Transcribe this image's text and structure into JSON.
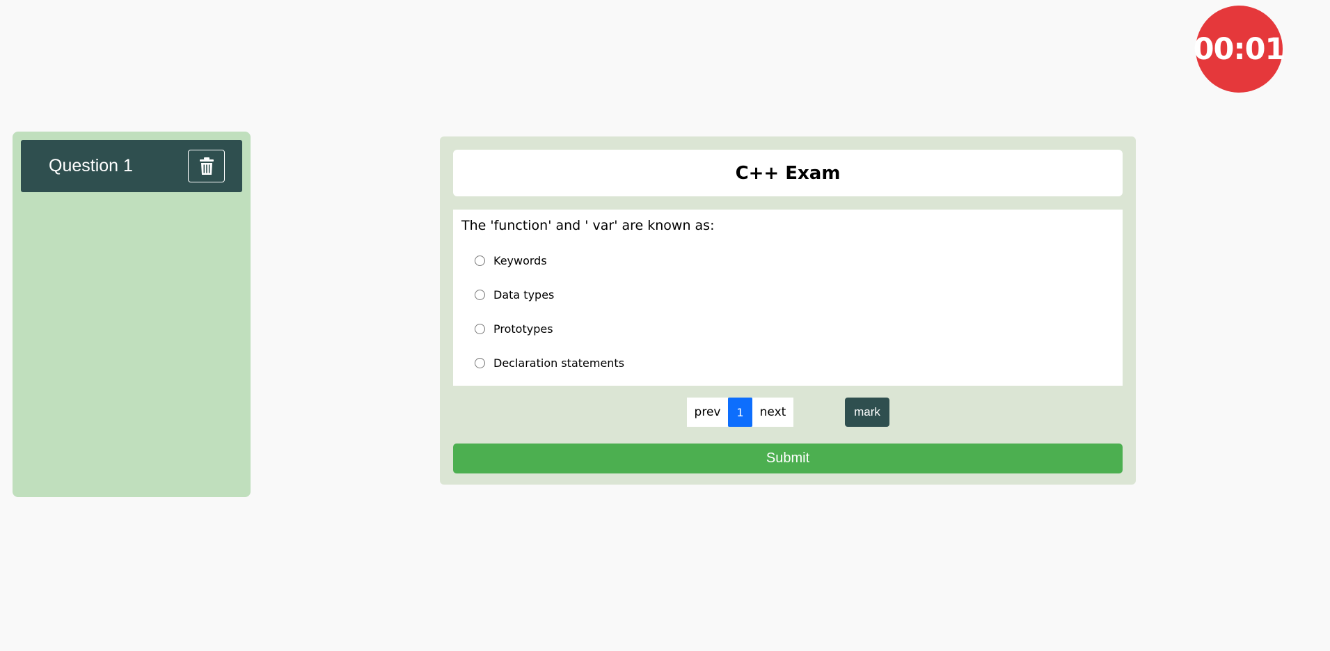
{
  "timer": {
    "text": "00:01",
    "color": "#e5383b"
  },
  "sidebar": {
    "items": [
      {
        "label": "Question 1",
        "icon": "trash-icon"
      }
    ]
  },
  "exam": {
    "title": "C++ Exam",
    "question": {
      "text": "The 'function' and ' var' are known as:",
      "options": [
        "Keywords",
        "Data types",
        "Prototypes",
        "Declaration statements"
      ]
    },
    "pagination": {
      "prev": "prev",
      "current": "1",
      "next": "next"
    },
    "mark_label": "mark",
    "submit_label": "Submit"
  },
  "colors": {
    "background": "#f9f9f9",
    "sidebar_bg": "#c0dfbd",
    "sidebar_item_bg": "#2f4f4f",
    "exam_bg": "#dbe5d4",
    "active_page": "#0d6efd",
    "submit": "#4caf50"
  }
}
